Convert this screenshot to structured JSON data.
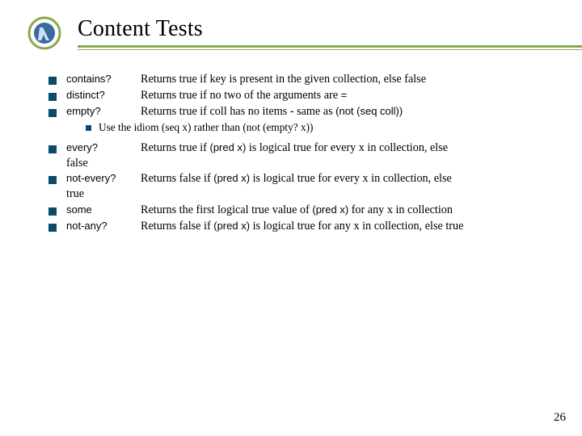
{
  "title": "Content Tests",
  "group1": [
    {
      "term": "contains?",
      "desc_pre": "Returns true if key is present in the given collection, else false",
      "code": "",
      "desc_post": ""
    },
    {
      "term": "distinct?",
      "desc_pre": "Returns true if no two of the arguments are ",
      "code": "=",
      "desc_post": ""
    },
    {
      "term": "empty?",
      "desc_pre": "Returns true if coll has no items - same as ",
      "code": "(not (seq coll))",
      "desc_post": ""
    }
  ],
  "subnote": "Use the idiom (seq x) rather than (not (empty? x))",
  "group2": [
    {
      "term": "every?",
      "desc_pre": "Returns true if ",
      "code": "(pred x)",
      "desc_post": " is logical true for every x in collection, else",
      "trail": "false"
    },
    {
      "term": "not-every?",
      "desc_pre": "Returns false if ",
      "code": "(pred x)",
      "desc_post": " is logical true for every x in collection, else",
      "trail": "true"
    },
    {
      "term": " some",
      "desc_pre": "Returns the first logical true value of ",
      "code": "(pred x)",
      "desc_post": " for any x in collection",
      "trail": ""
    },
    {
      "term": "not-any?",
      "desc_pre": "Returns false if ",
      "code": "(pred x)",
      "desc_post": " is logical true for any x in collection, else true",
      "trail": ""
    }
  ],
  "page_number": "26"
}
